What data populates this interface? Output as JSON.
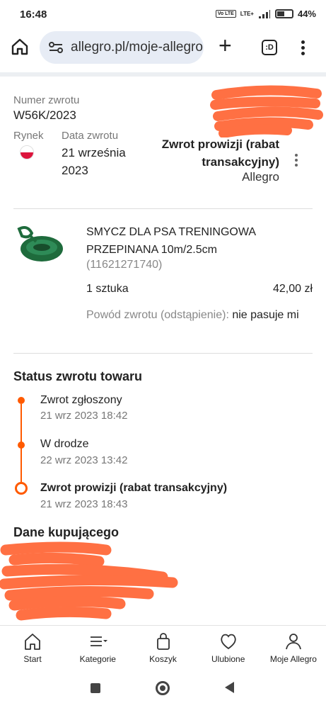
{
  "status_bar": {
    "time": "16:48",
    "network": "LTE+",
    "volte": "Vo LTE",
    "battery": "44%"
  },
  "browser": {
    "url": "allegro.pl/moje-allegro",
    "tab_label": ":D"
  },
  "return_info": {
    "number_label": "Numer zwrotu",
    "number_value": "W56K/2023",
    "market_label": "Rynek",
    "date_label": "Data zwrotu",
    "date_value": "21 września 2023",
    "status": "Zwrot prowizji (rabat transakcyjny)",
    "seller": "Allegro"
  },
  "product": {
    "name": "SMYCZ DLA PSA TRENINGOWA PRZEPINANA 10m/2.5cm",
    "id": "(11621271740)",
    "quantity": "1 sztuka",
    "price": "42,00 zł",
    "reason_label": "Powód zwrotu (odstąpienie):",
    "reason_value": "nie pasuje mi"
  },
  "timeline": {
    "title": "Status zwrotu towaru",
    "steps": [
      {
        "title": "Zwrot zgłoszony",
        "date": "21 wrz 2023 18:42"
      },
      {
        "title": "W drodze",
        "date": "22 wrz 2023 13:42"
      },
      {
        "title": "Zwrot prowizji (rabat transakcyjny)",
        "date": "21 wrz 2023 18:43"
      }
    ]
  },
  "buyer": {
    "title": "Dane kupującego"
  },
  "bottom_nav": {
    "items": [
      {
        "label": "Start",
        "icon": "home-icon"
      },
      {
        "label": "Kategorie",
        "icon": "menu-icon"
      },
      {
        "label": "Koszyk",
        "icon": "cart-icon"
      },
      {
        "label": "Ulubione",
        "icon": "heart-icon"
      },
      {
        "label": "Moje Allegro",
        "icon": "user-icon"
      }
    ]
  },
  "colors": {
    "accent": "#ff5a00",
    "redaction": "#ff7043"
  }
}
